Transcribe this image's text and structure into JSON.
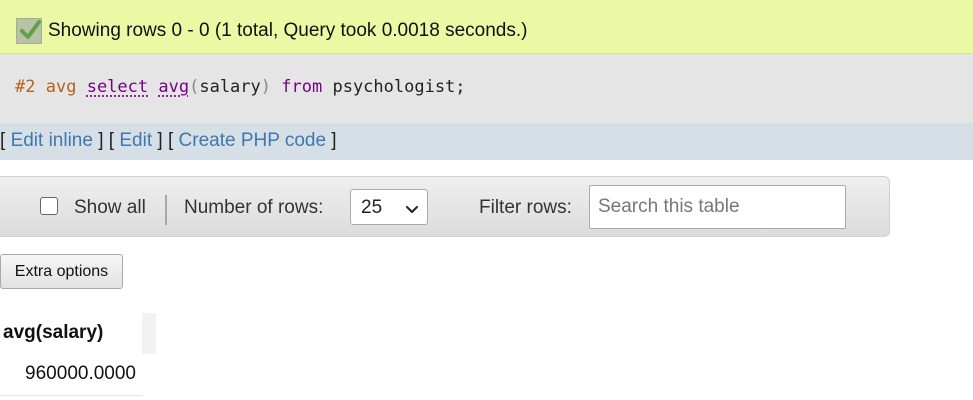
{
  "status": {
    "message": "Showing rows 0 - 0 (1 total, Query took 0.0018 seconds.)",
    "icon": "checkmark-icon"
  },
  "sql": {
    "number": "#2",
    "prefix": "avg",
    "kw_select": "select",
    "fn_avg": "avg",
    "paren_open": "(",
    "column": "salary",
    "paren_close": ")",
    "kw_from": "from",
    "table": "psychologist;"
  },
  "actions": {
    "open1": "[ ",
    "edit_inline": "Edit inline",
    "sep1": " ] [ ",
    "edit": "Edit",
    "sep2": " ] [ ",
    "create_php": "Create PHP code",
    "close": " ]"
  },
  "navigation": {
    "show_all_label": "Show all",
    "number_of_rows_label": "Number of rows:",
    "rows_selected": "25",
    "filter_label": "Filter rows:",
    "search_placeholder": "Search this table"
  },
  "extra_options_label": "Extra options",
  "results": {
    "columns": [
      "avg(salary)"
    ],
    "rows": [
      [
        "960000.0000"
      ]
    ]
  },
  "colors": {
    "success_bg": "#ebf8a4",
    "sql_bg": "#e5e5e5",
    "link": "#3d78b0",
    "keyword": "#770088",
    "number": "#b4621c"
  }
}
